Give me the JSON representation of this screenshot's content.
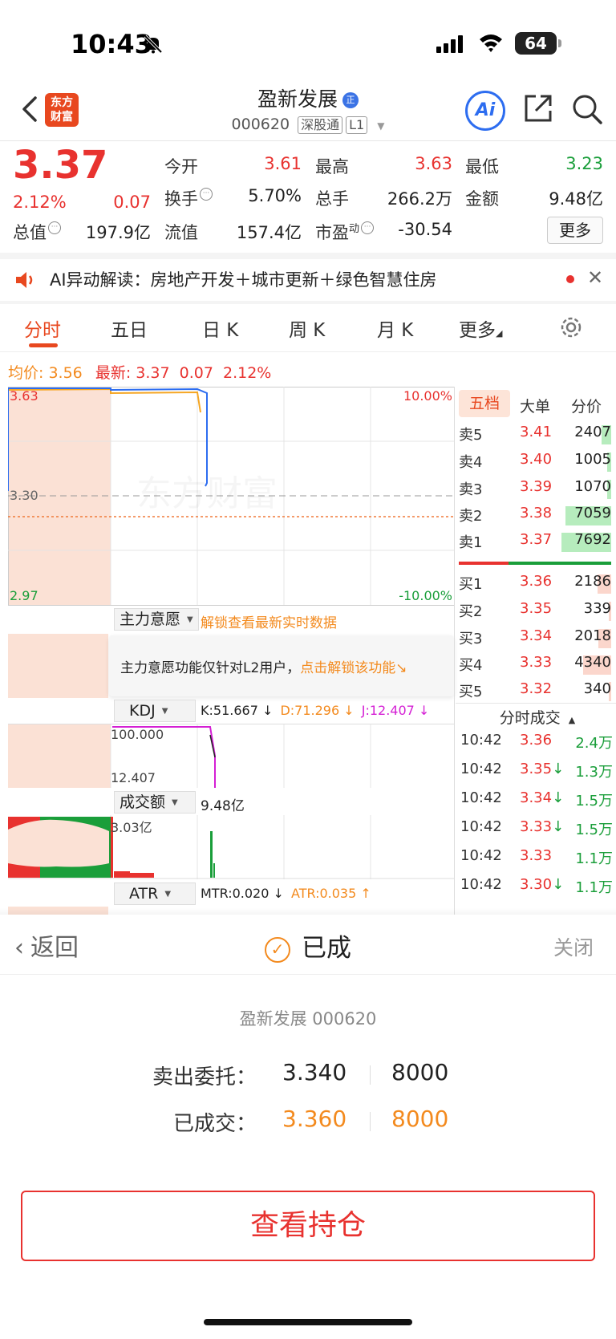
{
  "status": {
    "time": "10:43",
    "battery": "64"
  },
  "header": {
    "logo_text_top": "东方",
    "logo_text_bottom": "财富",
    "stock_name": "盈新发展",
    "badge": "正",
    "code": "000620",
    "market_tag": "深股通",
    "level_tag": "L1",
    "ai_label": "Ai"
  },
  "quote": {
    "price": "3.37",
    "pct": "2.12%",
    "change": "0.07",
    "open_label": "今开",
    "open": "3.61",
    "high_label": "最高",
    "high": "3.63",
    "low_label": "最低",
    "low": "3.23",
    "turnover_label": "换手",
    "turnover": "5.70%",
    "volume_label": "总手",
    "volume": "266.2万",
    "amount_label": "金额",
    "amount": "9.48亿",
    "mktcap_label": "总值",
    "mktcap": "197.9亿",
    "float_label": "流值",
    "float": "157.4亿",
    "pe_label": "市盈",
    "pe_sup": "动",
    "pe": "-30.54",
    "more_label": "更多"
  },
  "ai_banner": {
    "text": "AI异动解读：房地产开发＋城市更新＋绿色智慧住房"
  },
  "tabs": [
    "分时",
    "五日",
    "日 K",
    "周 K",
    "月 K",
    "更多"
  ],
  "avg_line": {
    "avg_label": "均价:",
    "avg": "3.56",
    "latest_label": "最新:",
    "latest": "3.37",
    "chg": "0.07",
    "pct": "2.12%"
  },
  "chart": {
    "top_price": "3.63",
    "mid_price": "3.30",
    "bottom_price": "2.97",
    "top_pct": "10.00%",
    "bottom_pct": "-10.00%",
    "watermark": "东方财富"
  },
  "indicator_main": {
    "name": "主力意愿",
    "link": "解锁查看最新实时数据",
    "lock_text": "主力意愿功能仅针对L2用户，",
    "lock_link": "点击解锁该功能"
  },
  "kdj": {
    "name": "KDJ",
    "k": "K:51.667 ↓",
    "d": "D:71.296 ↓",
    "j": "J:12.407 ↓",
    "top": "100.000",
    "bottom": "12.407"
  },
  "amount_ind": {
    "name": "成交额",
    "value": "9.48亿",
    "max": "3.03亿"
  },
  "atr": {
    "name": "ATR",
    "mtr": "MTR:0.020 ↓",
    "atr": "ATR:0.035 ↑"
  },
  "orderbook": {
    "tabs": [
      "五档",
      "大单",
      "分价"
    ],
    "asks": [
      {
        "label": "卖5",
        "price": "3.41",
        "vol": "2407",
        "bar": 0.2
      },
      {
        "label": "卖4",
        "price": "3.40",
        "vol": "1005",
        "bar": 0.08
      },
      {
        "label": "卖3",
        "price": "3.39",
        "vol": "1070",
        "bar": 0.08
      },
      {
        "label": "卖2",
        "price": "3.38",
        "vol": "7059",
        "bar": 0.92
      },
      {
        "label": "卖1",
        "price": "3.37",
        "vol": "7692",
        "bar": 1.0
      }
    ],
    "bids": [
      {
        "label": "买1",
        "price": "3.36",
        "vol": "2186",
        "bar": 0.28
      },
      {
        "label": "买2",
        "price": "3.35",
        "vol": "339",
        "bar": 0.05
      },
      {
        "label": "买3",
        "price": "3.34",
        "vol": "2018",
        "bar": 0.26
      },
      {
        "label": "买4",
        "price": "3.33",
        "vol": "4340",
        "bar": 0.56
      },
      {
        "label": "买5",
        "price": "3.32",
        "vol": "340",
        "bar": 0.05
      }
    ],
    "ticks_header": "分时成交",
    "ticks": [
      {
        "time": "10:42",
        "price": "3.36",
        "arrow": "",
        "vol": "2.4万"
      },
      {
        "time": "10:42",
        "price": "3.35",
        "arrow": "↓",
        "vol": "1.3万"
      },
      {
        "time": "10:42",
        "price": "3.34",
        "arrow": "↓",
        "vol": "1.5万"
      },
      {
        "time": "10:42",
        "price": "3.33",
        "arrow": "↓",
        "vol": "1.5万"
      },
      {
        "time": "10:42",
        "price": "3.33",
        "arrow": "",
        "vol": "1.1万"
      },
      {
        "time": "10:42",
        "price": "3.30",
        "arrow": "↓",
        "vol": "1.1万"
      }
    ]
  },
  "sheet": {
    "back": "返回",
    "status": "已成",
    "close": "关闭",
    "stock": "盈新发展 000620",
    "order_label": "卖出委托：",
    "order_price": "3.340",
    "order_qty": "8000",
    "filled_label": "已成交：",
    "filled_price": "3.360",
    "filled_qty": "8000",
    "button": "查看持仓"
  },
  "colors": {
    "up": "#e8322f",
    "down": "#1a9e3a",
    "accent": "#e8481f",
    "orange": "#f38a1e",
    "blue": "#2d6df0"
  }
}
